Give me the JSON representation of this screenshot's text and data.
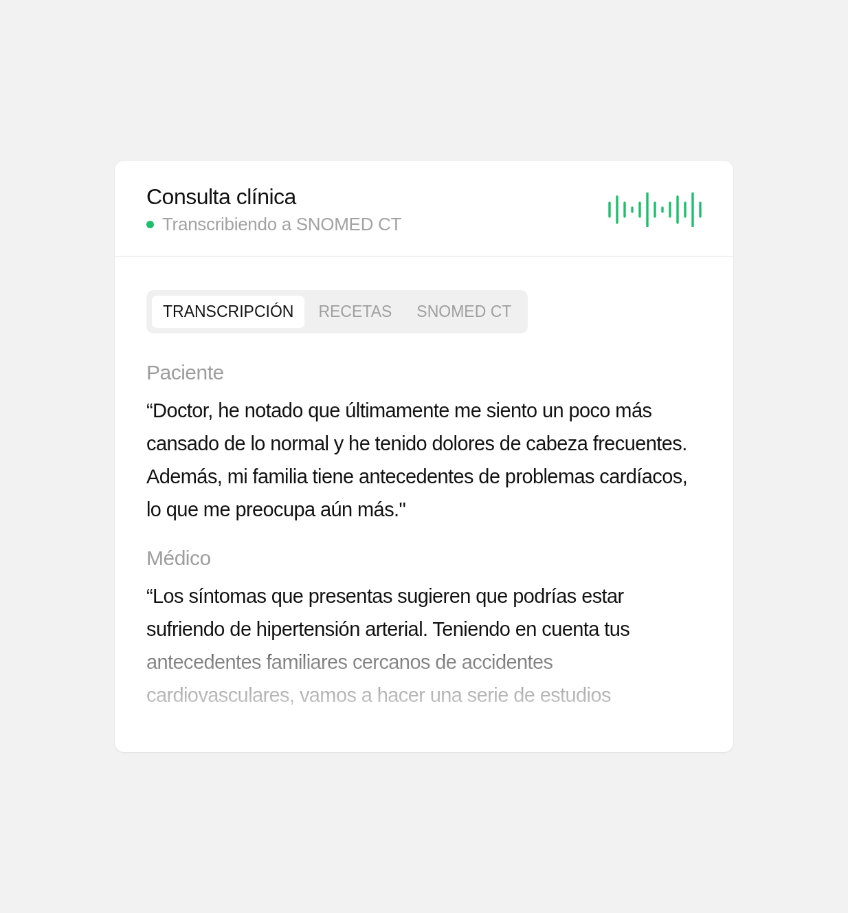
{
  "header": {
    "title": "Consulta clínica",
    "status": "Transcribiendo a SNOMED CT"
  },
  "tabs": [
    {
      "label": "TRANSCRIPCIÓN",
      "selected": true
    },
    {
      "label": "RECETAS",
      "selected": false
    },
    {
      "label": "SNOMED CT",
      "selected": false
    }
  ],
  "transcript": [
    {
      "speaker": "Paciente",
      "text": "“Doctor, he notado que últimamente me siento un poco más cansado de lo normal y he tenido dolores de cabeza frecuentes. Además, mi familia tiene antecedentes de problemas cardíacos, lo que me preocupa aún más.\"",
      "faded": false
    },
    {
      "speaker": "Médico",
      "text": "“Los síntomas que presentas sugieren que podrías estar sufriendo de hipertensión arterial. Teniendo en cuenta tus antecedentes familiares cercanos de accidentes cardiovasculares, vamos a hacer una serie de estudios",
      "faded": true
    }
  ]
}
